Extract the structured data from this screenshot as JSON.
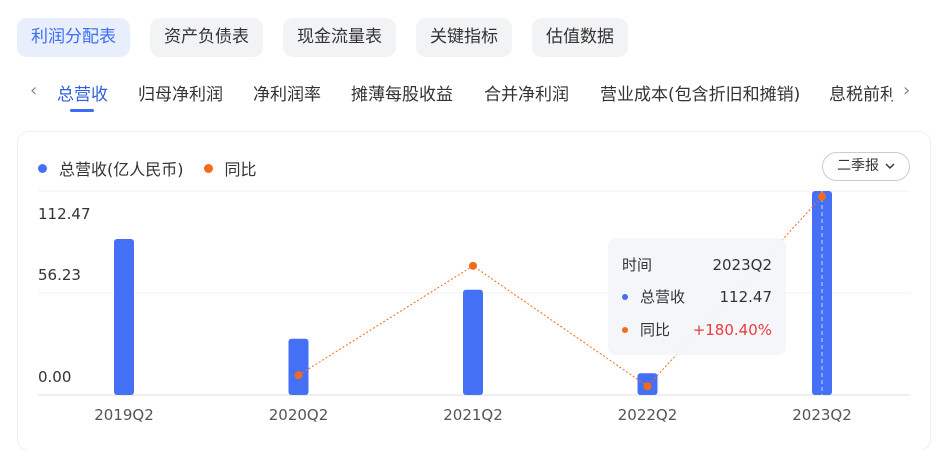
{
  "top_tabs": [
    {
      "label": "利润分配表",
      "active": true
    },
    {
      "label": "资产负债表",
      "active": false
    },
    {
      "label": "现金流量表",
      "active": false
    },
    {
      "label": "关键指标",
      "active": false
    },
    {
      "label": "估值数据",
      "active": false
    }
  ],
  "sub_tabs": [
    {
      "label": "总营收",
      "active": true
    },
    {
      "label": "归母净利润",
      "active": false
    },
    {
      "label": "净利润率",
      "active": false
    },
    {
      "label": "摊薄每股收益",
      "active": false
    },
    {
      "label": "合并净利润",
      "active": false
    },
    {
      "label": "营业成本(包含折旧和摊销)",
      "active": false
    },
    {
      "label": "息税前利",
      "active": false
    }
  ],
  "icons": {
    "left": "chevron-left-icon",
    "right": "chevron-right-icon",
    "dropdown": "chevron-down-icon"
  },
  "legend": {
    "revenue": "总营收(亿人民币)",
    "yoy": "同比"
  },
  "period_select": "二季报",
  "colors": {
    "bar": "#4470f5",
    "line": "#f26a1b",
    "active": "#3b6ef5",
    "negative": "#e93c3c"
  },
  "chart_data": {
    "type": "bar",
    "categories": [
      "2019Q2",
      "2020Q2",
      "2021Q2",
      "2022Q2",
      "2023Q2"
    ],
    "series": [
      {
        "name": "总营收(亿人民币)",
        "values": [
          86,
          31,
          58,
          12,
          112.47
        ]
      },
      {
        "name": "同比",
        "values": [
          null,
          -63,
          86,
          -78,
          180.4
        ]
      }
    ],
    "y_ticks": [
      "112.47",
      "56.23",
      "0.00"
    ],
    "ylim": [
      0,
      112.47
    ],
    "grid": true,
    "legend_position": "top-left"
  },
  "tooltip": {
    "time_label": "时间",
    "time_value": "2023Q2",
    "revenue_label": "总营收",
    "revenue_value": "112.47",
    "yoy_label": "同比",
    "yoy_value": "+180.40%"
  }
}
